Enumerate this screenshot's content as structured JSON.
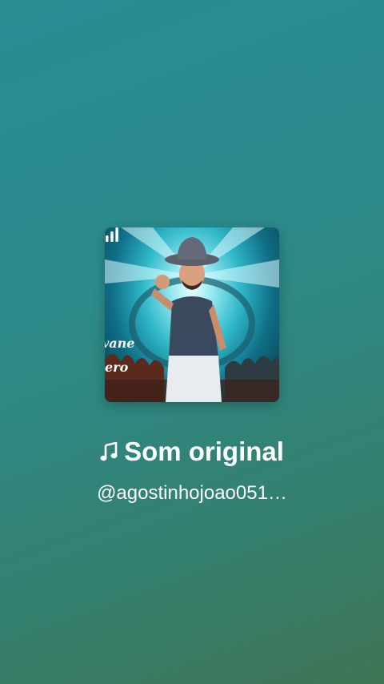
{
  "sound": {
    "title": "Som original",
    "author_handle": "@agostinhojoao051…",
    "note_icon": "music-note-icon",
    "playing_icon": "audio-bars-icon",
    "cover_overlay_text": [
      "vane",
      "ero"
    ]
  },
  "colors": {
    "background_top": "#2a8d95",
    "background_bottom": "#3e7455",
    "text": "#ffffff"
  }
}
